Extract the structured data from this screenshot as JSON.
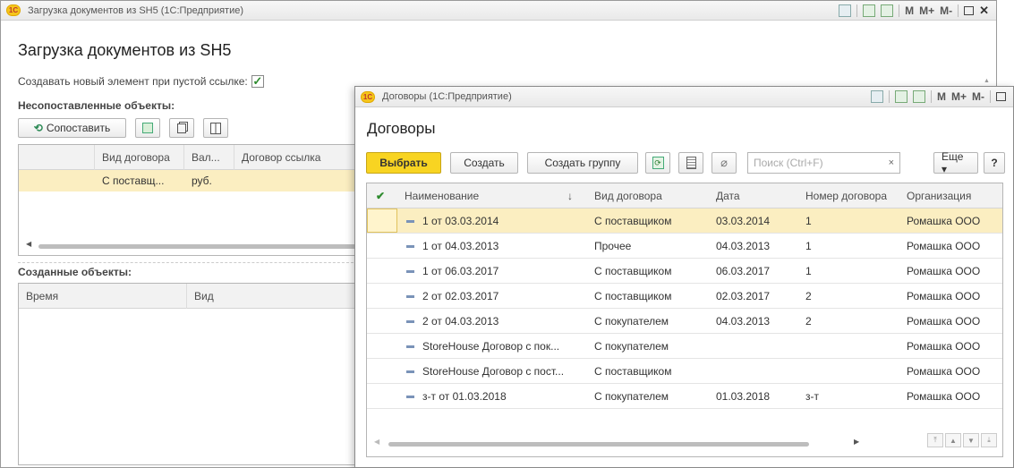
{
  "back_window": {
    "title": "Загрузка документов из SH5  (1С:Предприятие)",
    "form_title": "Загрузка документов из SH5",
    "checkbox_label": "Создавать новый элемент при пустой ссылке:",
    "checkbox_checked": "✓",
    "unmatched_label": "Несопоставленные объекты:",
    "match_button": "Сопоставить",
    "unmatched_columns": [
      "Вид договора",
      "Вал...",
      "Договор ссылка"
    ],
    "unmatched_rows": [
      [
        "С поставщ...",
        "руб.",
        ""
      ]
    ],
    "created_label": "Созданные объекты:",
    "created_columns": [
      "Время",
      "Вид"
    ]
  },
  "front_window": {
    "title": "Договоры  (1С:Предприятие)",
    "form_title": "Договоры",
    "buttons": {
      "select": "Выбрать",
      "create": "Создать",
      "create_group": "Создать группу",
      "more": "Еще ▾",
      "help": "?"
    },
    "search_placeholder": "Поиск (Ctrl+F)",
    "search_clear": "×",
    "columns": [
      "Наименование",
      "Вид договора",
      "Дата",
      "Номер договора",
      "Организация"
    ],
    "sort_indicator": "↓",
    "rows": [
      [
        "1 от 03.03.2014",
        "С поставщиком",
        "03.03.2014",
        "1",
        "Ромашка ООО"
      ],
      [
        "1 от 04.03.2013",
        "Прочее",
        "04.03.2013",
        "1",
        "Ромашка ООО"
      ],
      [
        "1 от 06.03.2017",
        "С поставщиком",
        "06.03.2017",
        "1",
        "Ромашка ООО"
      ],
      [
        "2 от 02.03.2017",
        "С поставщиком",
        "02.03.2017",
        "2",
        "Ромашка ООО"
      ],
      [
        "2 от 04.03.2013",
        "С покупателем",
        "04.03.2013",
        "2",
        "Ромашка ООО"
      ],
      [
        "StoreHouse Договор с пок...",
        "С покупателем",
        "",
        "",
        "Ромашка ООО"
      ],
      [
        "StoreHouse Договор с пост...",
        "С поставщиком",
        "",
        "",
        "Ромашка ООО"
      ],
      [
        "з-т от 01.03.2018",
        "С покупателем",
        "01.03.2018",
        "з-т",
        "Ромашка ООО"
      ]
    ],
    "selected_row": 0
  },
  "titlebar_text": {
    "m": "M",
    "mplus": "M+",
    "mminus": "M-",
    "close": "✕"
  },
  "colors": {
    "accent_button": "#f8d422",
    "selected_row": "#fbeec1",
    "check_green": "#2e8b2e"
  }
}
